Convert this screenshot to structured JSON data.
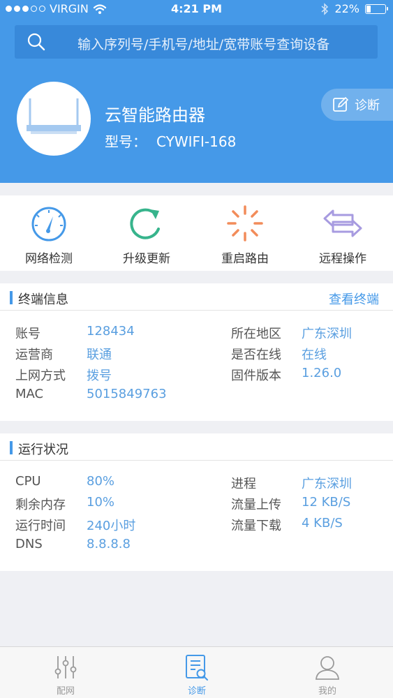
{
  "status_bar": {
    "carrier": "VIRGIN",
    "time": "4:21 PM",
    "battery": "22%",
    "battery_level": 0.22
  },
  "search": {
    "placeholder": "输入序列号/手机号/地址/宽带账号查询设备"
  },
  "device": {
    "name": "云智能路由器",
    "model_label": "型号：",
    "model_value": "CYWIFI-168",
    "diagnose_label": "诊断"
  },
  "actions": [
    {
      "label": "网络检测",
      "icon": "speedometer-icon"
    },
    {
      "label": "升级更新",
      "icon": "refresh-icon"
    },
    {
      "label": "重启路由",
      "icon": "restart-spinner-icon"
    },
    {
      "label": "远程操作",
      "icon": "swap-arrows-icon"
    }
  ],
  "terminal_info": {
    "title": "终端信息",
    "link": "查看终端",
    "left": [
      {
        "label": "账号",
        "value": "128434"
      },
      {
        "label": "运营商",
        "value": "联通"
      },
      {
        "label": "上网方式",
        "value": "拨号"
      },
      {
        "label": "MAC",
        "value": "5015849763"
      }
    ],
    "right": [
      {
        "label": "所在地区",
        "value": "广东深圳"
      },
      {
        "label": "是否在线",
        "value": "在线"
      },
      {
        "label": "固件版本",
        "value": "1.26.0"
      }
    ]
  },
  "running_status": {
    "title": "运行状况",
    "left": [
      {
        "label": "CPU",
        "value": "80%"
      },
      {
        "label": "剩余内存",
        "value": "10%"
      },
      {
        "label": "运行时间",
        "value": "240小时"
      },
      {
        "label": "DNS",
        "value": "8.8.8.8"
      }
    ],
    "right": [
      {
        "label": "进程",
        "value": "广东深圳"
      },
      {
        "label": "流量上传",
        "value": "12 KB/S"
      },
      {
        "label": "流量下载",
        "value": "4 KB/S"
      }
    ]
  },
  "tabs": [
    {
      "label": "配网",
      "icon": "sliders-icon",
      "active": false
    },
    {
      "label": "诊断",
      "icon": "document-search-icon",
      "active": true
    },
    {
      "label": "我的",
      "icon": "user-icon",
      "active": false
    }
  ],
  "colors": {
    "primary": "#4599e8",
    "accent_green": "#37b48c",
    "accent_orange": "#f28c5a",
    "accent_purple": "#a79be0"
  }
}
